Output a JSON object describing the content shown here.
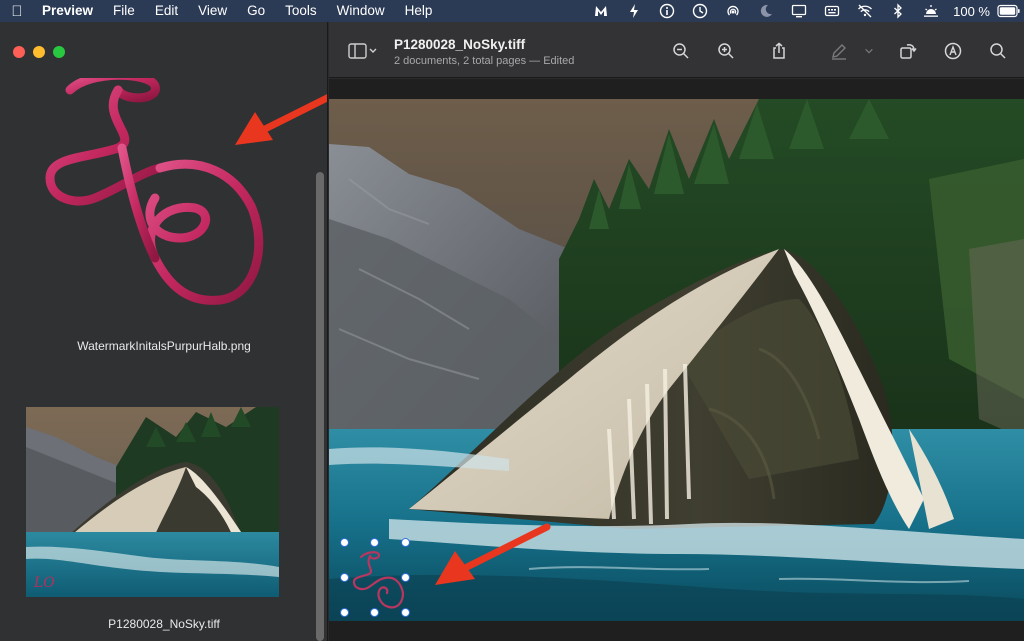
{
  "menubar": {
    "app_name": "Preview",
    "items": [
      "File",
      "Edit",
      "View",
      "Go",
      "Tools",
      "Window",
      "Help"
    ],
    "battery": "100 %"
  },
  "document": {
    "title": "P1280028_NoSky.tiff",
    "subtitle": "2 documents, 2 total pages — Edited"
  },
  "sidebar": {
    "thumbnails": [
      {
        "label": "WatermarkInitalsPurpurHalb.png"
      },
      {
        "label": "P1280028_NoSky.tiff"
      }
    ]
  },
  "watermark": {
    "text": "LO",
    "color": "#c3285f"
  },
  "colors": {
    "arrow": "#e8361f",
    "selection": "#2f6fe0",
    "menubar": "#2b3a55"
  }
}
